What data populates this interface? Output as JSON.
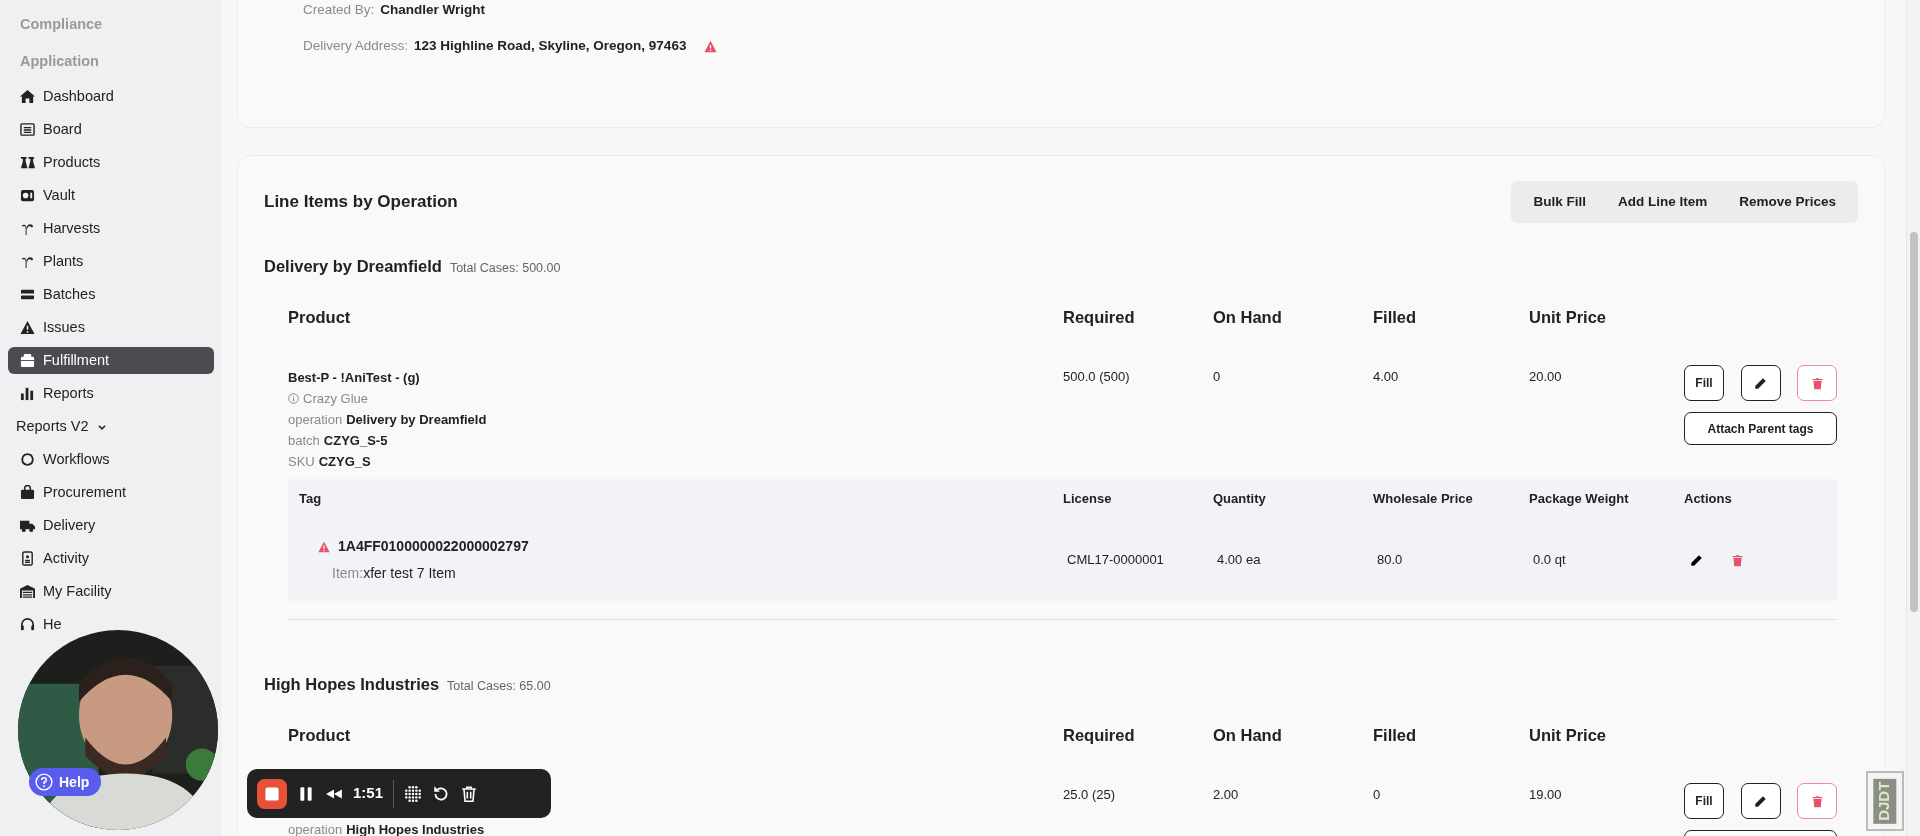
{
  "sidebar": {
    "items": [
      {
        "kind": "heading",
        "label": "Compliance"
      },
      {
        "kind": "heading",
        "label": "Application"
      },
      {
        "kind": "link",
        "label": "Dashboard",
        "selected": false
      },
      {
        "kind": "link",
        "label": "Board",
        "selected": false
      },
      {
        "kind": "link",
        "label": "Products",
        "selected": false
      },
      {
        "kind": "link",
        "label": "Vault",
        "selected": false
      },
      {
        "kind": "link",
        "label": "Harvests",
        "selected": false
      },
      {
        "kind": "link",
        "label": "Plants",
        "selected": false
      },
      {
        "kind": "link",
        "label": "Batches",
        "selected": false
      },
      {
        "kind": "link",
        "label": "Issues",
        "selected": false
      },
      {
        "kind": "link",
        "label": "Fulfillment",
        "selected": true
      },
      {
        "kind": "link",
        "label": "Reports",
        "selected": false
      },
      {
        "kind": "group",
        "label": "Reports V2",
        "selected": false,
        "expanded": false
      },
      {
        "kind": "link",
        "label": "Workflows",
        "selected": false
      },
      {
        "kind": "link",
        "label": "Procurement",
        "selected": false
      },
      {
        "kind": "link",
        "label": "Delivery",
        "selected": false
      },
      {
        "kind": "link",
        "label": "Activity",
        "selected": false
      },
      {
        "kind": "link",
        "label": "My Facility",
        "selected": false
      },
      {
        "kind": "link",
        "label": "He",
        "selected": false
      }
    ]
  },
  "order_details": [
    {
      "label": "Created By:",
      "value": "Chandler Wright",
      "warning": false
    },
    {
      "label": "Delivery Address:",
      "value": "123 Highline Road, Skyline, Oregon, 97463",
      "warning": true
    }
  ],
  "line_items": {
    "title": "Line Items by Operation",
    "actions": [
      "Bulk Fill",
      "Add Line Item",
      "Remove Prices"
    ],
    "groups": [
      {
        "name": "Delivery by Dreamfield",
        "total": "Total Cases: 500.00",
        "columns": [
          "Product",
          "Required",
          "On Hand",
          "Filled",
          "Unit Price"
        ],
        "rows": [
          {
            "product": "Best-P - !AniTest - (g)",
            "details": [
              {
                "kind": "info",
                "text": "Crazy Glue"
              },
              {
                "kind": "field",
                "label": "operation",
                "value": "Delivery by Dreamfield"
              },
              {
                "kind": "field",
                "label": "batch",
                "value": "CZYG_S-5"
              },
              {
                "kind": "field",
                "label": "SKU",
                "value": "CZYG_S"
              }
            ],
            "required": "500.0 (500)",
            "on_hand": "0",
            "filled": "4.00",
            "unit_price": "20.00",
            "fill_label": "Fill",
            "attach_button": true,
            "attach_label": "Attach Parent tags",
            "tags": {
              "columns": [
                "Tag",
                "License",
                "Quantity",
                "Wholesale Price",
                "Package Weight",
                "Actions"
              ],
              "rows": [
                {
                  "warning": true,
                  "tag": "1A4FF0100000022000002797",
                  "item_label": "Item:",
                  "item": "xfer test 7 Item",
                  "license": "CML17-0000001",
                  "quantity": "4.00 ea",
                  "wholesale_price": "80.0",
                  "package_weight": "0.0 qt"
                }
              ]
            }
          }
        ]
      },
      {
        "name": "High Hopes Industries",
        "total": "Total Cases: 65.00",
        "columns": [
          "Product",
          "Required",
          "On Hand",
          "Filled",
          "Unit Price"
        ],
        "rows": [
          {
            "details": [
              {
                "kind": "field",
                "label": "operation",
                "value": "High Hopes Industries"
              }
            ],
            "required": "25.0 (25)",
            "on_hand": "2.00",
            "filled": "0",
            "unit_price": "19.00",
            "fill_label": "Fill",
            "attach_button": true
          }
        ]
      }
    ]
  },
  "recorder": {
    "time": "1:51"
  },
  "help_button": "Help",
  "debug_toolbar": "DJDT"
}
